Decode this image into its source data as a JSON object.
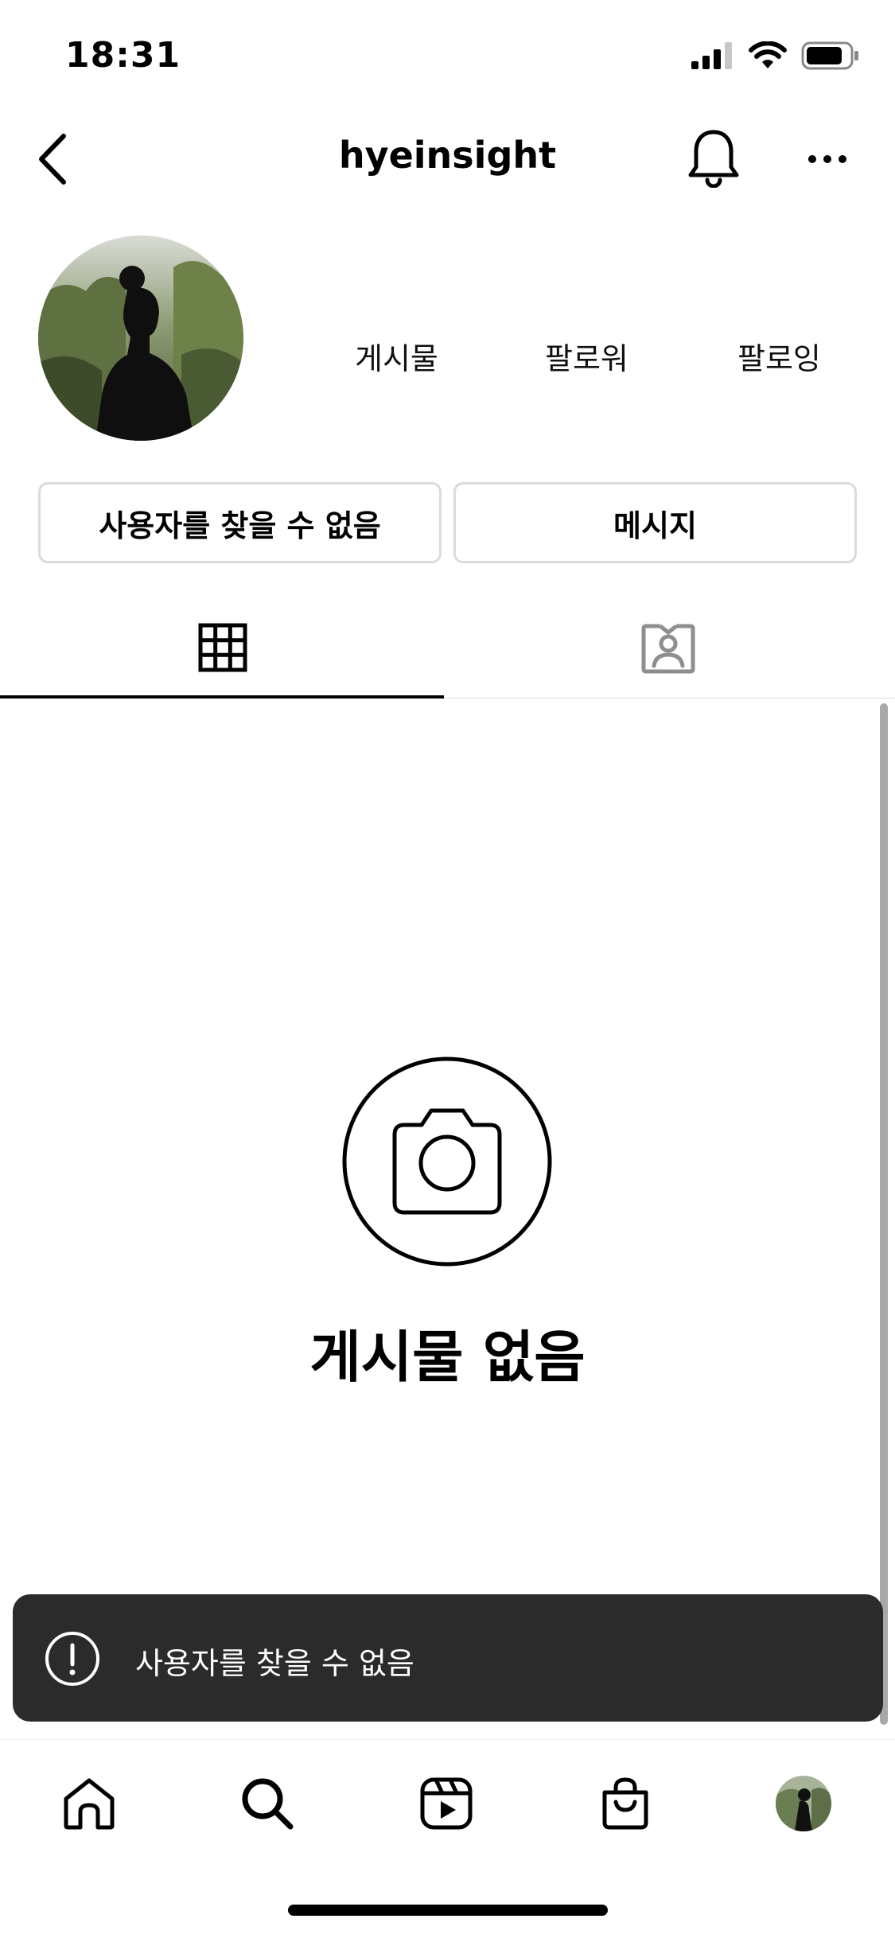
{
  "status_bar": {
    "time": "18:31"
  },
  "header": {
    "username": "hyeinsight",
    "icons": {
      "back": "chevron-left-icon",
      "notifications": "bell-icon",
      "more": "more-horizontal-icon"
    }
  },
  "profile": {
    "stats": {
      "posts_label": "게시물",
      "followers_label": "팔로워",
      "following_label": "팔로잉"
    },
    "buttons": {
      "status_label": "사용자를 찾을 수 없음",
      "message_label": "메시지"
    }
  },
  "tabs": [
    {
      "icon": "grid-icon",
      "selected": true
    },
    {
      "icon": "tagged-person-icon",
      "selected": false
    }
  ],
  "empty_state": {
    "icon": "camera-icon",
    "title": "게시물 없음"
  },
  "toast": {
    "icon": "alert-circle-icon",
    "message": "사용자를 찾을 수 없음"
  },
  "bottom_nav": [
    {
      "icon": "home-icon"
    },
    {
      "icon": "search-icon"
    },
    {
      "icon": "reels-icon"
    },
    {
      "icon": "shop-bag-icon"
    },
    {
      "icon": "profile-avatar-icon"
    }
  ],
  "colors": {
    "text": "#000000",
    "border": "#dbdbdb",
    "toast_bg": "#2b2b2b",
    "scrollbar": "#a8a8a8"
  }
}
